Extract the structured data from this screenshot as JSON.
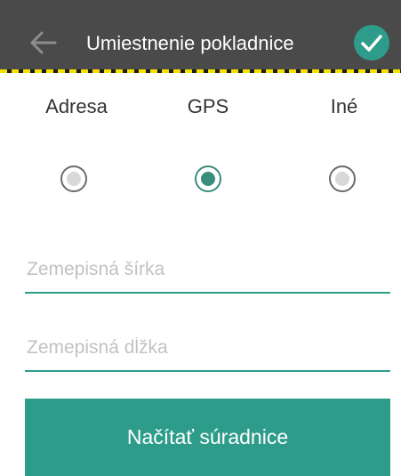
{
  "header": {
    "title": "Umiestnenie pokladnice",
    "back_icon": "arrow-left-icon",
    "confirm_icon": "check-icon",
    "background": "#4a4a4a",
    "accent": "#2e9c8a"
  },
  "location_type": {
    "options": [
      {
        "label": "Adresa",
        "selected": false
      },
      {
        "label": "GPS",
        "selected": true
      },
      {
        "label": "Iné",
        "selected": false
      }
    ]
  },
  "form": {
    "latitude": {
      "placeholder": "Zemepisná šírka",
      "value": ""
    },
    "longitude": {
      "placeholder": "Zemepisná dĺžka",
      "value": ""
    }
  },
  "actions": {
    "load_coordinates_label": "Načítať súradnice"
  }
}
